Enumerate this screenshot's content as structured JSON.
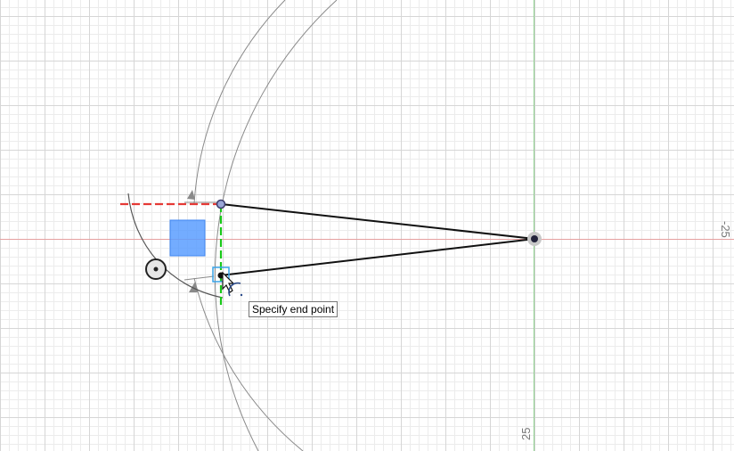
{
  "canvas": {
    "tooltip_text": "Specify end point",
    "ruler_right_label": "-25",
    "ruler_bottom_label": "25"
  },
  "colors": {
    "construction_line_red": "#e53935",
    "construction_line_green": "#19c919",
    "axis_red": "#e6a0a0",
    "axis_green": "#8fd18f",
    "sketch_line": "#111111",
    "dimension_arc": "#8a8a8a",
    "glyph_fill": "#5a9dff",
    "snap_box": "#39a4e8"
  },
  "icons": {
    "center_point": "circle-dot-icon",
    "cursor": "pointer-arrow-icon",
    "arc_hint": "arc-cursor-icon",
    "constraint_glyph": "blue-square-icon"
  }
}
